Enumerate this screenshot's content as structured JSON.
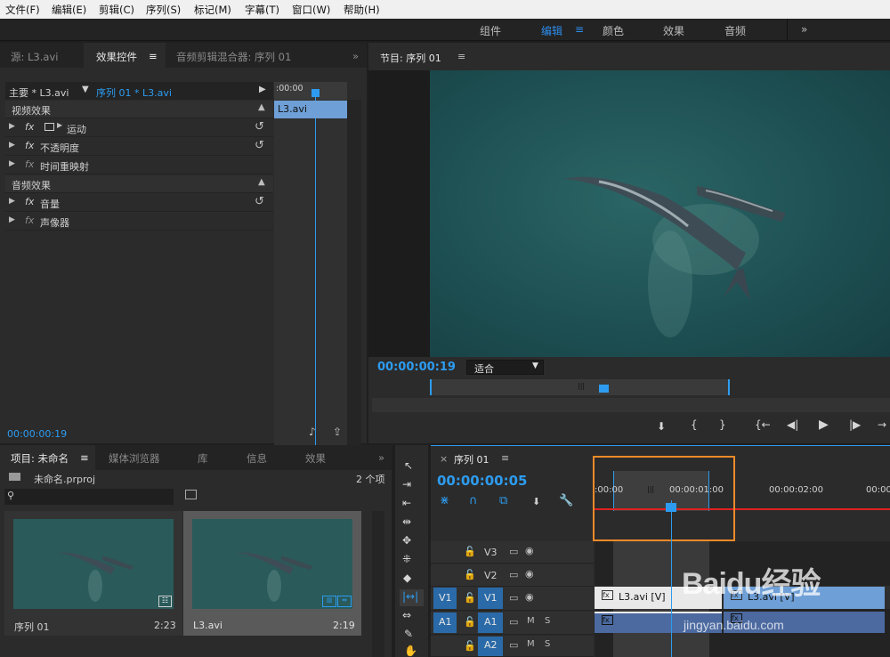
{
  "menu": [
    "文件(F)",
    "编辑(E)",
    "剪辑(C)",
    "序列(S)",
    "标记(M)",
    "字幕(T)",
    "窗口(W)",
    "帮助(H)"
  ],
  "workspaces": {
    "items": [
      "组件",
      "编辑",
      "颜色",
      "效果",
      "音频"
    ],
    "active": "编辑",
    "menu_icon": "≡",
    "more": "»"
  },
  "source_panel": {
    "tabs": [
      "源: L3.avi",
      "效果控件",
      "音频剪辑混合器: 序列 01"
    ],
    "active_tab": "效果控件",
    "tab_menu": "≡",
    "more": "»",
    "master_label": "主要 * L3.avi",
    "seq_label": "序列 01 * L3.avi",
    "mini_timecode": ":00:00",
    "clip_label": "L3.avi",
    "video_effects": "视频效果",
    "effects": [
      {
        "fx": "fx",
        "name": "运动"
      },
      {
        "fx": "fx",
        "name": "不透明度"
      },
      {
        "fx": "fx",
        "name": "时间重映射"
      }
    ],
    "audio_effects": "音频效果",
    "audio": [
      {
        "fx": "fx",
        "name": "音量"
      },
      {
        "fx": "fx",
        "name": "声像器"
      }
    ],
    "timecode": "00:00:00:19"
  },
  "program_monitor": {
    "title": "节目: 序列 01",
    "title_menu": "≡",
    "timecode": "00:00:00:19",
    "fit": "适合"
  },
  "project_panel": {
    "tabs": [
      "项目: 未命名",
      "媒体浏览器",
      "库",
      "信息",
      "效果"
    ],
    "tab_menu": "≡",
    "more": "»",
    "file": "未命名.prproj",
    "count": "2 个项",
    "items": [
      {
        "name": "序列 01",
        "duration": "2:23"
      },
      {
        "name": "L3.avi",
        "duration": "2:19"
      }
    ]
  },
  "timeline": {
    "close": "×",
    "title": "序列 01",
    "title_menu": "≡",
    "timecode": "00:00:00:05",
    "ruler": [
      ":00:00",
      "00:00:01:00",
      "00:00:02:00",
      "00:00"
    ],
    "tracks": [
      {
        "name": "V3",
        "target": ""
      },
      {
        "name": "V2",
        "target": ""
      },
      {
        "name": "V1",
        "target": "V1"
      },
      {
        "name": "A1",
        "target": "A1"
      },
      {
        "name": "A2",
        "target": ""
      }
    ],
    "clip_v1": "L3.avi [V]",
    "clip_v1b": "L3.avi [V]",
    "m": "M",
    "s": "S"
  },
  "watermark": {
    "logo": "Baidu经验",
    "url": "jingyan.baidu.com"
  },
  "colors": {
    "accent": "#2d8ceb",
    "highlight": "#f08a2a",
    "playhead": "#2d9cf0"
  }
}
